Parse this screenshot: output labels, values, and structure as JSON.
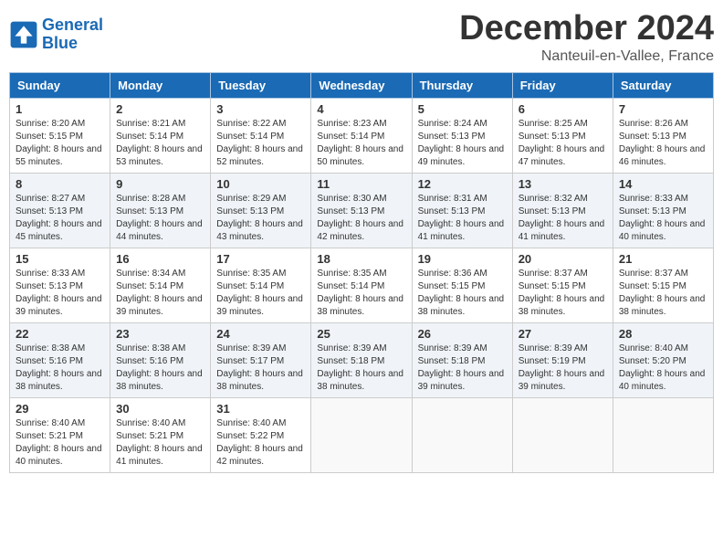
{
  "logo": {
    "line1": "General",
    "line2": "Blue"
  },
  "header": {
    "month": "December 2024",
    "location": "Nanteuil-en-Vallee, France"
  },
  "weekdays": [
    "Sunday",
    "Monday",
    "Tuesday",
    "Wednesday",
    "Thursday",
    "Friday",
    "Saturday"
  ],
  "weeks": [
    [
      {
        "day": "1",
        "sunrise": "Sunrise: 8:20 AM",
        "sunset": "Sunset: 5:15 PM",
        "daylight": "Daylight: 8 hours and 55 minutes."
      },
      {
        "day": "2",
        "sunrise": "Sunrise: 8:21 AM",
        "sunset": "Sunset: 5:14 PM",
        "daylight": "Daylight: 8 hours and 53 minutes."
      },
      {
        "day": "3",
        "sunrise": "Sunrise: 8:22 AM",
        "sunset": "Sunset: 5:14 PM",
        "daylight": "Daylight: 8 hours and 52 minutes."
      },
      {
        "day": "4",
        "sunrise": "Sunrise: 8:23 AM",
        "sunset": "Sunset: 5:14 PM",
        "daylight": "Daylight: 8 hours and 50 minutes."
      },
      {
        "day": "5",
        "sunrise": "Sunrise: 8:24 AM",
        "sunset": "Sunset: 5:13 PM",
        "daylight": "Daylight: 8 hours and 49 minutes."
      },
      {
        "day": "6",
        "sunrise": "Sunrise: 8:25 AM",
        "sunset": "Sunset: 5:13 PM",
        "daylight": "Daylight: 8 hours and 47 minutes."
      },
      {
        "day": "7",
        "sunrise": "Sunrise: 8:26 AM",
        "sunset": "Sunset: 5:13 PM",
        "daylight": "Daylight: 8 hours and 46 minutes."
      }
    ],
    [
      {
        "day": "8",
        "sunrise": "Sunrise: 8:27 AM",
        "sunset": "Sunset: 5:13 PM",
        "daylight": "Daylight: 8 hours and 45 minutes."
      },
      {
        "day": "9",
        "sunrise": "Sunrise: 8:28 AM",
        "sunset": "Sunset: 5:13 PM",
        "daylight": "Daylight: 8 hours and 44 minutes."
      },
      {
        "day": "10",
        "sunrise": "Sunrise: 8:29 AM",
        "sunset": "Sunset: 5:13 PM",
        "daylight": "Daylight: 8 hours and 43 minutes."
      },
      {
        "day": "11",
        "sunrise": "Sunrise: 8:30 AM",
        "sunset": "Sunset: 5:13 PM",
        "daylight": "Daylight: 8 hours and 42 minutes."
      },
      {
        "day": "12",
        "sunrise": "Sunrise: 8:31 AM",
        "sunset": "Sunset: 5:13 PM",
        "daylight": "Daylight: 8 hours and 41 minutes."
      },
      {
        "day": "13",
        "sunrise": "Sunrise: 8:32 AM",
        "sunset": "Sunset: 5:13 PM",
        "daylight": "Daylight: 8 hours and 41 minutes."
      },
      {
        "day": "14",
        "sunrise": "Sunrise: 8:33 AM",
        "sunset": "Sunset: 5:13 PM",
        "daylight": "Daylight: 8 hours and 40 minutes."
      }
    ],
    [
      {
        "day": "15",
        "sunrise": "Sunrise: 8:33 AM",
        "sunset": "Sunset: 5:13 PM",
        "daylight": "Daylight: 8 hours and 39 minutes."
      },
      {
        "day": "16",
        "sunrise": "Sunrise: 8:34 AM",
        "sunset": "Sunset: 5:14 PM",
        "daylight": "Daylight: 8 hours and 39 minutes."
      },
      {
        "day": "17",
        "sunrise": "Sunrise: 8:35 AM",
        "sunset": "Sunset: 5:14 PM",
        "daylight": "Daylight: 8 hours and 39 minutes."
      },
      {
        "day": "18",
        "sunrise": "Sunrise: 8:35 AM",
        "sunset": "Sunset: 5:14 PM",
        "daylight": "Daylight: 8 hours and 38 minutes."
      },
      {
        "day": "19",
        "sunrise": "Sunrise: 8:36 AM",
        "sunset": "Sunset: 5:15 PM",
        "daylight": "Daylight: 8 hours and 38 minutes."
      },
      {
        "day": "20",
        "sunrise": "Sunrise: 8:37 AM",
        "sunset": "Sunset: 5:15 PM",
        "daylight": "Daylight: 8 hours and 38 minutes."
      },
      {
        "day": "21",
        "sunrise": "Sunrise: 8:37 AM",
        "sunset": "Sunset: 5:15 PM",
        "daylight": "Daylight: 8 hours and 38 minutes."
      }
    ],
    [
      {
        "day": "22",
        "sunrise": "Sunrise: 8:38 AM",
        "sunset": "Sunset: 5:16 PM",
        "daylight": "Daylight: 8 hours and 38 minutes."
      },
      {
        "day": "23",
        "sunrise": "Sunrise: 8:38 AM",
        "sunset": "Sunset: 5:16 PM",
        "daylight": "Daylight: 8 hours and 38 minutes."
      },
      {
        "day": "24",
        "sunrise": "Sunrise: 8:39 AM",
        "sunset": "Sunset: 5:17 PM",
        "daylight": "Daylight: 8 hours and 38 minutes."
      },
      {
        "day": "25",
        "sunrise": "Sunrise: 8:39 AM",
        "sunset": "Sunset: 5:18 PM",
        "daylight": "Daylight: 8 hours and 38 minutes."
      },
      {
        "day": "26",
        "sunrise": "Sunrise: 8:39 AM",
        "sunset": "Sunset: 5:18 PM",
        "daylight": "Daylight: 8 hours and 39 minutes."
      },
      {
        "day": "27",
        "sunrise": "Sunrise: 8:39 AM",
        "sunset": "Sunset: 5:19 PM",
        "daylight": "Daylight: 8 hours and 39 minutes."
      },
      {
        "day": "28",
        "sunrise": "Sunrise: 8:40 AM",
        "sunset": "Sunset: 5:20 PM",
        "daylight": "Daylight: 8 hours and 40 minutes."
      }
    ],
    [
      {
        "day": "29",
        "sunrise": "Sunrise: 8:40 AM",
        "sunset": "Sunset: 5:21 PM",
        "daylight": "Daylight: 8 hours and 40 minutes."
      },
      {
        "day": "30",
        "sunrise": "Sunrise: 8:40 AM",
        "sunset": "Sunset: 5:21 PM",
        "daylight": "Daylight: 8 hours and 41 minutes."
      },
      {
        "day": "31",
        "sunrise": "Sunrise: 8:40 AM",
        "sunset": "Sunset: 5:22 PM",
        "daylight": "Daylight: 8 hours and 42 minutes."
      },
      null,
      null,
      null,
      null
    ]
  ]
}
